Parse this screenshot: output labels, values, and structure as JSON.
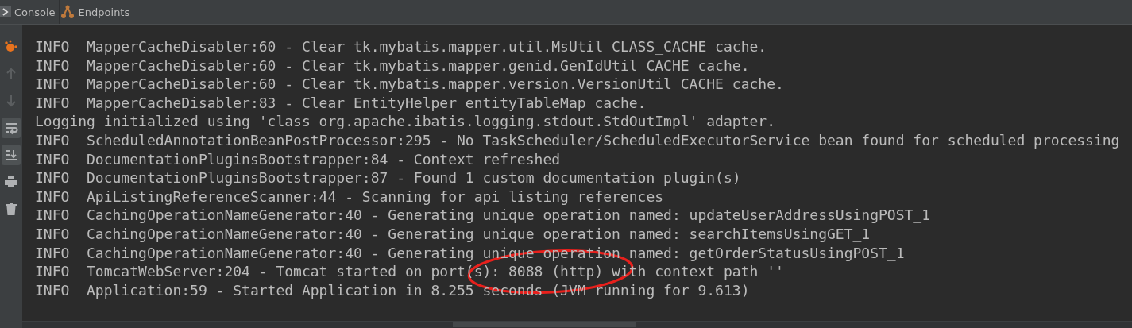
{
  "tabs": [
    {
      "label": "Console",
      "kind": "console"
    },
    {
      "label": "Endpoints",
      "kind": "endpoints"
    }
  ],
  "toolbar": [
    {
      "kind": "spring"
    },
    {
      "kind": "up",
      "on": false,
      "disabled": true
    },
    {
      "kind": "down",
      "on": false,
      "disabled": true
    },
    {
      "kind": "wrap",
      "on": true,
      "disabled": false
    },
    {
      "kind": "scroll-end",
      "on": true,
      "disabled": false
    },
    {
      "kind": "print",
      "on": false,
      "disabled": false
    },
    {
      "kind": "trash",
      "on": false,
      "disabled": false
    }
  ],
  "log_lines": [
    "INFO  MapperCacheDisabler:60 - Clear tk.mybatis.mapper.util.MsUtil CLASS_CACHE cache.",
    "INFO  MapperCacheDisabler:60 - Clear tk.mybatis.mapper.genid.GenIdUtil CACHE cache.",
    "INFO  MapperCacheDisabler:60 - Clear tk.mybatis.mapper.version.VersionUtil CACHE cache.",
    "INFO  MapperCacheDisabler:83 - Clear EntityHelper entityTableMap cache.",
    "Logging initialized using 'class org.apache.ibatis.logging.stdout.StdOutImpl' adapter.",
    "INFO  ScheduledAnnotationBeanPostProcessor:295 - No TaskScheduler/ScheduledExecutorService bean found for scheduled processing",
    "INFO  DocumentationPluginsBootstrapper:84 - Context refreshed",
    "INFO  DocumentationPluginsBootstrapper:87 - Found 1 custom documentation plugin(s)",
    "INFO  ApiListingReferenceScanner:44 - Scanning for api listing references",
    "INFO  CachingOperationNameGenerator:40 - Generating unique operation named: updateUserAddressUsingPOST_1",
    "INFO  CachingOperationNameGenerator:40 - Generating unique operation named: searchItemsUsingGET_1",
    "INFO  CachingOperationNameGenerator:40 - Generating unique operation named: getOrderStatusUsingPOST_1",
    "INFO  TomcatWebServer:204 - Tomcat started on port(s): 8088 (http) with context path ''",
    "INFO  Application:59 - Started Application in 8.255 seconds (JVM running for 9.613)"
  ]
}
